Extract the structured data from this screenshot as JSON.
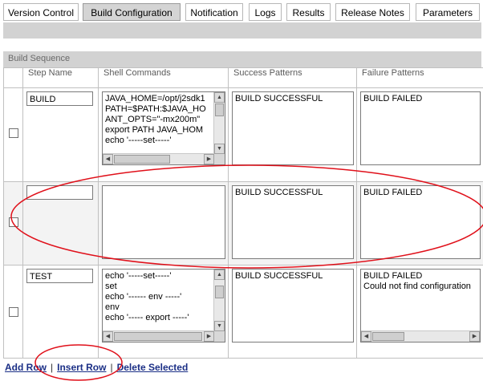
{
  "tabs": [
    "Version Control",
    "Build Configuration",
    "Notification",
    "Logs",
    "Results",
    "Release Notes",
    "Parameters"
  ],
  "section_title": "Build Sequence",
  "columns": [
    "Step Name",
    "Shell Commands",
    "Success Patterns",
    "Failure Patterns"
  ],
  "rows": [
    {
      "step_name": "BUILD",
      "shell_lines": [
        "JAVA_HOME=/opt/j2sdk1",
        "PATH=$PATH:$JAVA_HO",
        "ANT_OPTS=\"-mx200m\"",
        "export PATH JAVA_HOM",
        "echo '-----set-----'"
      ],
      "success_lines": [
        "BUILD SUCCESSFUL"
      ],
      "failure_lines": [
        "BUILD FAILED"
      ]
    },
    {
      "step_name": "",
      "shell_lines": [],
      "success_lines": [
        "BUILD SUCCESSFUL"
      ],
      "failure_lines": [
        "BUILD FAILED"
      ]
    },
    {
      "step_name": "TEST",
      "shell_lines": [
        "echo '-----set-----'",
        "set",
        "echo '------ env -----'",
        "env",
        "echo '----- export -----'"
      ],
      "success_lines": [
        "BUILD SUCCESSFUL"
      ],
      "failure_lines": [
        "BUILD FAILED",
        "Could not find configuration"
      ]
    }
  ],
  "actions": {
    "add_row": "Add Row",
    "insert_row": "Insert Row",
    "delete_selected": "Delete Selected",
    "separator": "|"
  },
  "colors": {
    "annotation": "#e0101a",
    "link": "#1b2f86",
    "bar": "#d2d2d2"
  }
}
